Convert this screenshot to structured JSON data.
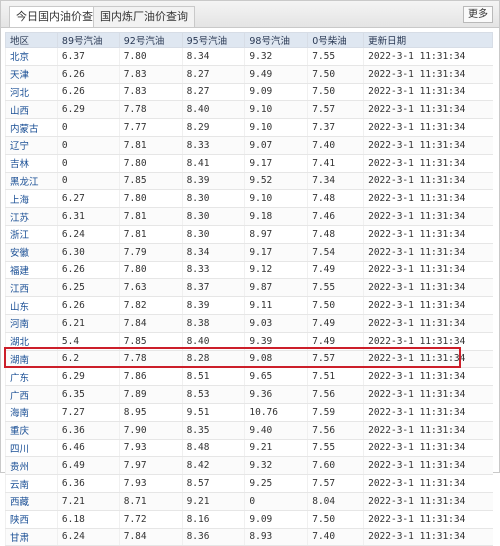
{
  "tabs": [
    {
      "label": "今日国内油价查询"
    },
    {
      "label": "国内炼厂油价查询"
    }
  ],
  "more_label": "更多",
  "columns": [
    "地区",
    "89号汽油",
    "92号汽油",
    "95号汽油",
    "98号汽油",
    "0号柴油",
    "更新日期"
  ],
  "rows": [
    [
      "北京",
      "6.37",
      "7.80",
      "8.34",
      "9.32",
      "7.55",
      "2022-3-1 11:31:34"
    ],
    [
      "天津",
      "6.26",
      "7.83",
      "8.27",
      "9.49",
      "7.50",
      "2022-3-1 11:31:34"
    ],
    [
      "河北",
      "6.26",
      "7.83",
      "8.27",
      "9.09",
      "7.50",
      "2022-3-1 11:31:34"
    ],
    [
      "山西",
      "6.29",
      "7.78",
      "8.40",
      "9.10",
      "7.57",
      "2022-3-1 11:31:34"
    ],
    [
      "内蒙古",
      "0",
      "7.77",
      "8.29",
      "9.10",
      "7.37",
      "2022-3-1 11:31:34"
    ],
    [
      "辽宁",
      "0",
      "7.81",
      "8.33",
      "9.07",
      "7.40",
      "2022-3-1 11:31:34"
    ],
    [
      "吉林",
      "0",
      "7.80",
      "8.41",
      "9.17",
      "7.41",
      "2022-3-1 11:31:34"
    ],
    [
      "黑龙江",
      "0",
      "7.85",
      "8.39",
      "9.52",
      "7.34",
      "2022-3-1 11:31:34"
    ],
    [
      "上海",
      "6.27",
      "7.80",
      "8.30",
      "9.10",
      "7.48",
      "2022-3-1 11:31:34"
    ],
    [
      "江苏",
      "6.31",
      "7.81",
      "8.30",
      "9.18",
      "7.46",
      "2022-3-1 11:31:34"
    ],
    [
      "浙江",
      "6.24",
      "7.81",
      "8.30",
      "8.97",
      "7.48",
      "2022-3-1 11:31:34"
    ],
    [
      "安徽",
      "6.30",
      "7.79",
      "8.34",
      "9.17",
      "7.54",
      "2022-3-1 11:31:34"
    ],
    [
      "福建",
      "6.26",
      "7.80",
      "8.33",
      "9.12",
      "7.49",
      "2022-3-1 11:31:34"
    ],
    [
      "江西",
      "6.25",
      "7.63",
      "8.37",
      "9.87",
      "7.55",
      "2022-3-1 11:31:34"
    ],
    [
      "山东",
      "6.26",
      "7.82",
      "8.39",
      "9.11",
      "7.50",
      "2022-3-1 11:31:34"
    ],
    [
      "河南",
      "6.21",
      "7.84",
      "8.38",
      "9.03",
      "7.49",
      "2022-3-1 11:31:34"
    ],
    [
      "湖北",
      "5.4",
      "7.85",
      "8.40",
      "9.39",
      "7.49",
      "2022-3-1 11:31:34"
    ],
    [
      "湖南",
      "6.2",
      "7.78",
      "8.28",
      "9.08",
      "7.57",
      "2022-3-1 11:31:34"
    ],
    [
      "广东",
      "6.29",
      "7.86",
      "8.51",
      "9.65",
      "7.51",
      "2022-3-1 11:31:34"
    ],
    [
      "广西",
      "6.35",
      "7.89",
      "8.53",
      "9.36",
      "7.56",
      "2022-3-1 11:31:34"
    ],
    [
      "海南",
      "7.27",
      "8.95",
      "9.51",
      "10.76",
      "7.59",
      "2022-3-1 11:31:34"
    ],
    [
      "重庆",
      "6.36",
      "7.90",
      "8.35",
      "9.40",
      "7.56",
      "2022-3-1 11:31:34"
    ],
    [
      "四川",
      "6.46",
      "7.93",
      "8.48",
      "9.21",
      "7.55",
      "2022-3-1 11:31:34"
    ],
    [
      "贵州",
      "6.49",
      "7.97",
      "8.42",
      "9.32",
      "7.60",
      "2022-3-1 11:31:34"
    ],
    [
      "云南",
      "6.36",
      "7.93",
      "8.57",
      "9.25",
      "7.57",
      "2022-3-1 11:31:34"
    ],
    [
      "西藏",
      "7.21",
      "8.71",
      "9.21",
      "0",
      "8.04",
      "2022-3-1 11:31:34"
    ],
    [
      "陕西",
      "6.18",
      "7.72",
      "8.16",
      "9.09",
      "7.50",
      "2022-3-1 11:31:34"
    ],
    [
      "甘肃",
      "6.24",
      "7.84",
      "8.36",
      "8.93",
      "7.40",
      "2022-3-1 11:31:34"
    ]
  ],
  "highlight_color": "#cc1f2a",
  "header_bg": "#dfe7f1"
}
